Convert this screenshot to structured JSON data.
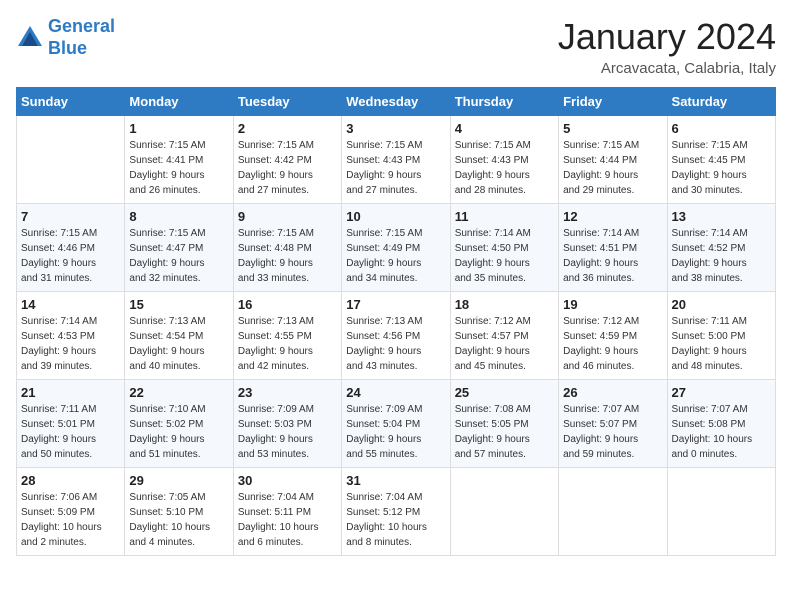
{
  "header": {
    "logo_line1": "General",
    "logo_line2": "Blue",
    "month": "January 2024",
    "location": "Arcavacata, Calabria, Italy"
  },
  "weekdays": [
    "Sunday",
    "Monday",
    "Tuesday",
    "Wednesday",
    "Thursday",
    "Friday",
    "Saturday"
  ],
  "weeks": [
    [
      {
        "day": "",
        "info": ""
      },
      {
        "day": "1",
        "info": "Sunrise: 7:15 AM\nSunset: 4:41 PM\nDaylight: 9 hours\nand 26 minutes."
      },
      {
        "day": "2",
        "info": "Sunrise: 7:15 AM\nSunset: 4:42 PM\nDaylight: 9 hours\nand 27 minutes."
      },
      {
        "day": "3",
        "info": "Sunrise: 7:15 AM\nSunset: 4:43 PM\nDaylight: 9 hours\nand 27 minutes."
      },
      {
        "day": "4",
        "info": "Sunrise: 7:15 AM\nSunset: 4:43 PM\nDaylight: 9 hours\nand 28 minutes."
      },
      {
        "day": "5",
        "info": "Sunrise: 7:15 AM\nSunset: 4:44 PM\nDaylight: 9 hours\nand 29 minutes."
      },
      {
        "day": "6",
        "info": "Sunrise: 7:15 AM\nSunset: 4:45 PM\nDaylight: 9 hours\nand 30 minutes."
      }
    ],
    [
      {
        "day": "7",
        "info": "Sunrise: 7:15 AM\nSunset: 4:46 PM\nDaylight: 9 hours\nand 31 minutes."
      },
      {
        "day": "8",
        "info": "Sunrise: 7:15 AM\nSunset: 4:47 PM\nDaylight: 9 hours\nand 32 minutes."
      },
      {
        "day": "9",
        "info": "Sunrise: 7:15 AM\nSunset: 4:48 PM\nDaylight: 9 hours\nand 33 minutes."
      },
      {
        "day": "10",
        "info": "Sunrise: 7:15 AM\nSunset: 4:49 PM\nDaylight: 9 hours\nand 34 minutes."
      },
      {
        "day": "11",
        "info": "Sunrise: 7:14 AM\nSunset: 4:50 PM\nDaylight: 9 hours\nand 35 minutes."
      },
      {
        "day": "12",
        "info": "Sunrise: 7:14 AM\nSunset: 4:51 PM\nDaylight: 9 hours\nand 36 minutes."
      },
      {
        "day": "13",
        "info": "Sunrise: 7:14 AM\nSunset: 4:52 PM\nDaylight: 9 hours\nand 38 minutes."
      }
    ],
    [
      {
        "day": "14",
        "info": "Sunrise: 7:14 AM\nSunset: 4:53 PM\nDaylight: 9 hours\nand 39 minutes."
      },
      {
        "day": "15",
        "info": "Sunrise: 7:13 AM\nSunset: 4:54 PM\nDaylight: 9 hours\nand 40 minutes."
      },
      {
        "day": "16",
        "info": "Sunrise: 7:13 AM\nSunset: 4:55 PM\nDaylight: 9 hours\nand 42 minutes."
      },
      {
        "day": "17",
        "info": "Sunrise: 7:13 AM\nSunset: 4:56 PM\nDaylight: 9 hours\nand 43 minutes."
      },
      {
        "day": "18",
        "info": "Sunrise: 7:12 AM\nSunset: 4:57 PM\nDaylight: 9 hours\nand 45 minutes."
      },
      {
        "day": "19",
        "info": "Sunrise: 7:12 AM\nSunset: 4:59 PM\nDaylight: 9 hours\nand 46 minutes."
      },
      {
        "day": "20",
        "info": "Sunrise: 7:11 AM\nSunset: 5:00 PM\nDaylight: 9 hours\nand 48 minutes."
      }
    ],
    [
      {
        "day": "21",
        "info": "Sunrise: 7:11 AM\nSunset: 5:01 PM\nDaylight: 9 hours\nand 50 minutes."
      },
      {
        "day": "22",
        "info": "Sunrise: 7:10 AM\nSunset: 5:02 PM\nDaylight: 9 hours\nand 51 minutes."
      },
      {
        "day": "23",
        "info": "Sunrise: 7:09 AM\nSunset: 5:03 PM\nDaylight: 9 hours\nand 53 minutes."
      },
      {
        "day": "24",
        "info": "Sunrise: 7:09 AM\nSunset: 5:04 PM\nDaylight: 9 hours\nand 55 minutes."
      },
      {
        "day": "25",
        "info": "Sunrise: 7:08 AM\nSunset: 5:05 PM\nDaylight: 9 hours\nand 57 minutes."
      },
      {
        "day": "26",
        "info": "Sunrise: 7:07 AM\nSunset: 5:07 PM\nDaylight: 9 hours\nand 59 minutes."
      },
      {
        "day": "27",
        "info": "Sunrise: 7:07 AM\nSunset: 5:08 PM\nDaylight: 10 hours\nand 0 minutes."
      }
    ],
    [
      {
        "day": "28",
        "info": "Sunrise: 7:06 AM\nSunset: 5:09 PM\nDaylight: 10 hours\nand 2 minutes."
      },
      {
        "day": "29",
        "info": "Sunrise: 7:05 AM\nSunset: 5:10 PM\nDaylight: 10 hours\nand 4 minutes."
      },
      {
        "day": "30",
        "info": "Sunrise: 7:04 AM\nSunset: 5:11 PM\nDaylight: 10 hours\nand 6 minutes."
      },
      {
        "day": "31",
        "info": "Sunrise: 7:04 AM\nSunset: 5:12 PM\nDaylight: 10 hours\nand 8 minutes."
      },
      {
        "day": "",
        "info": ""
      },
      {
        "day": "",
        "info": ""
      },
      {
        "day": "",
        "info": ""
      }
    ]
  ]
}
